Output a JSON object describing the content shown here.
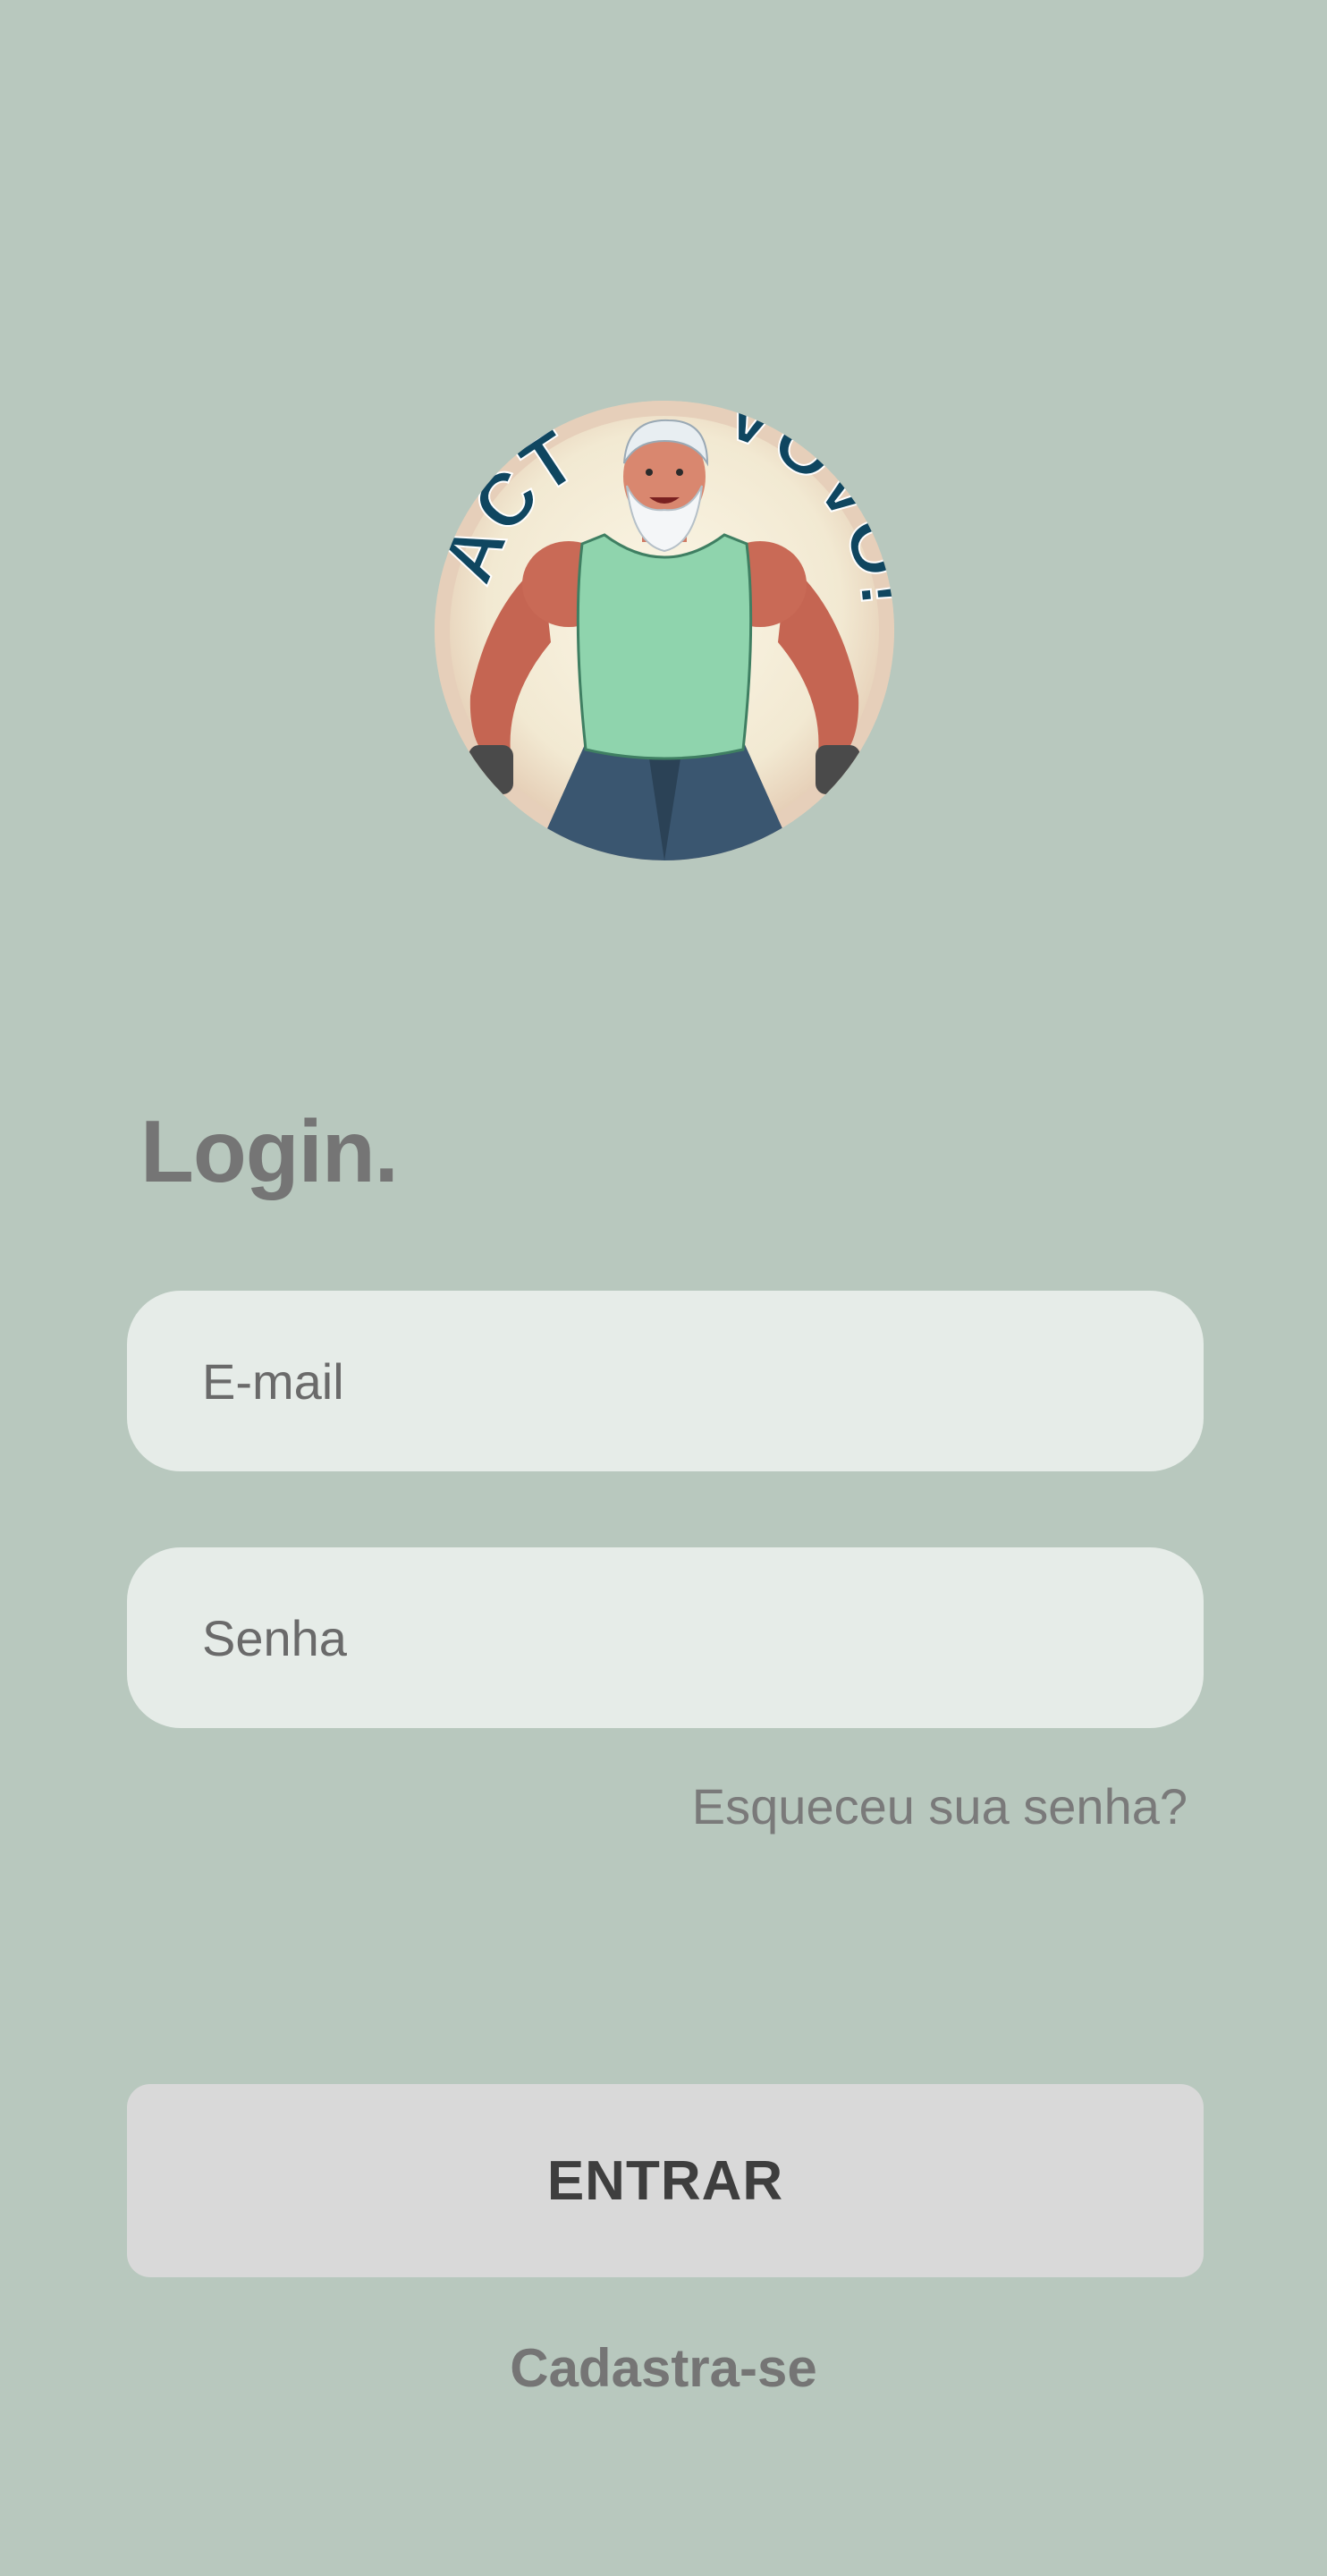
{
  "logo": {
    "text_left": "ACT",
    "text_right": "VOVÔ!"
  },
  "login": {
    "title": "Login.",
    "email_placeholder": "E-mail",
    "password_placeholder": "Senha",
    "forgot_label": "Esqueceu sua senha?",
    "enter_label": "ENTRAR",
    "signup_label": "Cadastra-se"
  },
  "colors": {
    "background": "#b8c8be",
    "field": "#e6ece8",
    "button": "#d9d9d9",
    "title_text": "#757575",
    "logo_text": "#0f4660",
    "shirt": "#8fd4ad"
  }
}
